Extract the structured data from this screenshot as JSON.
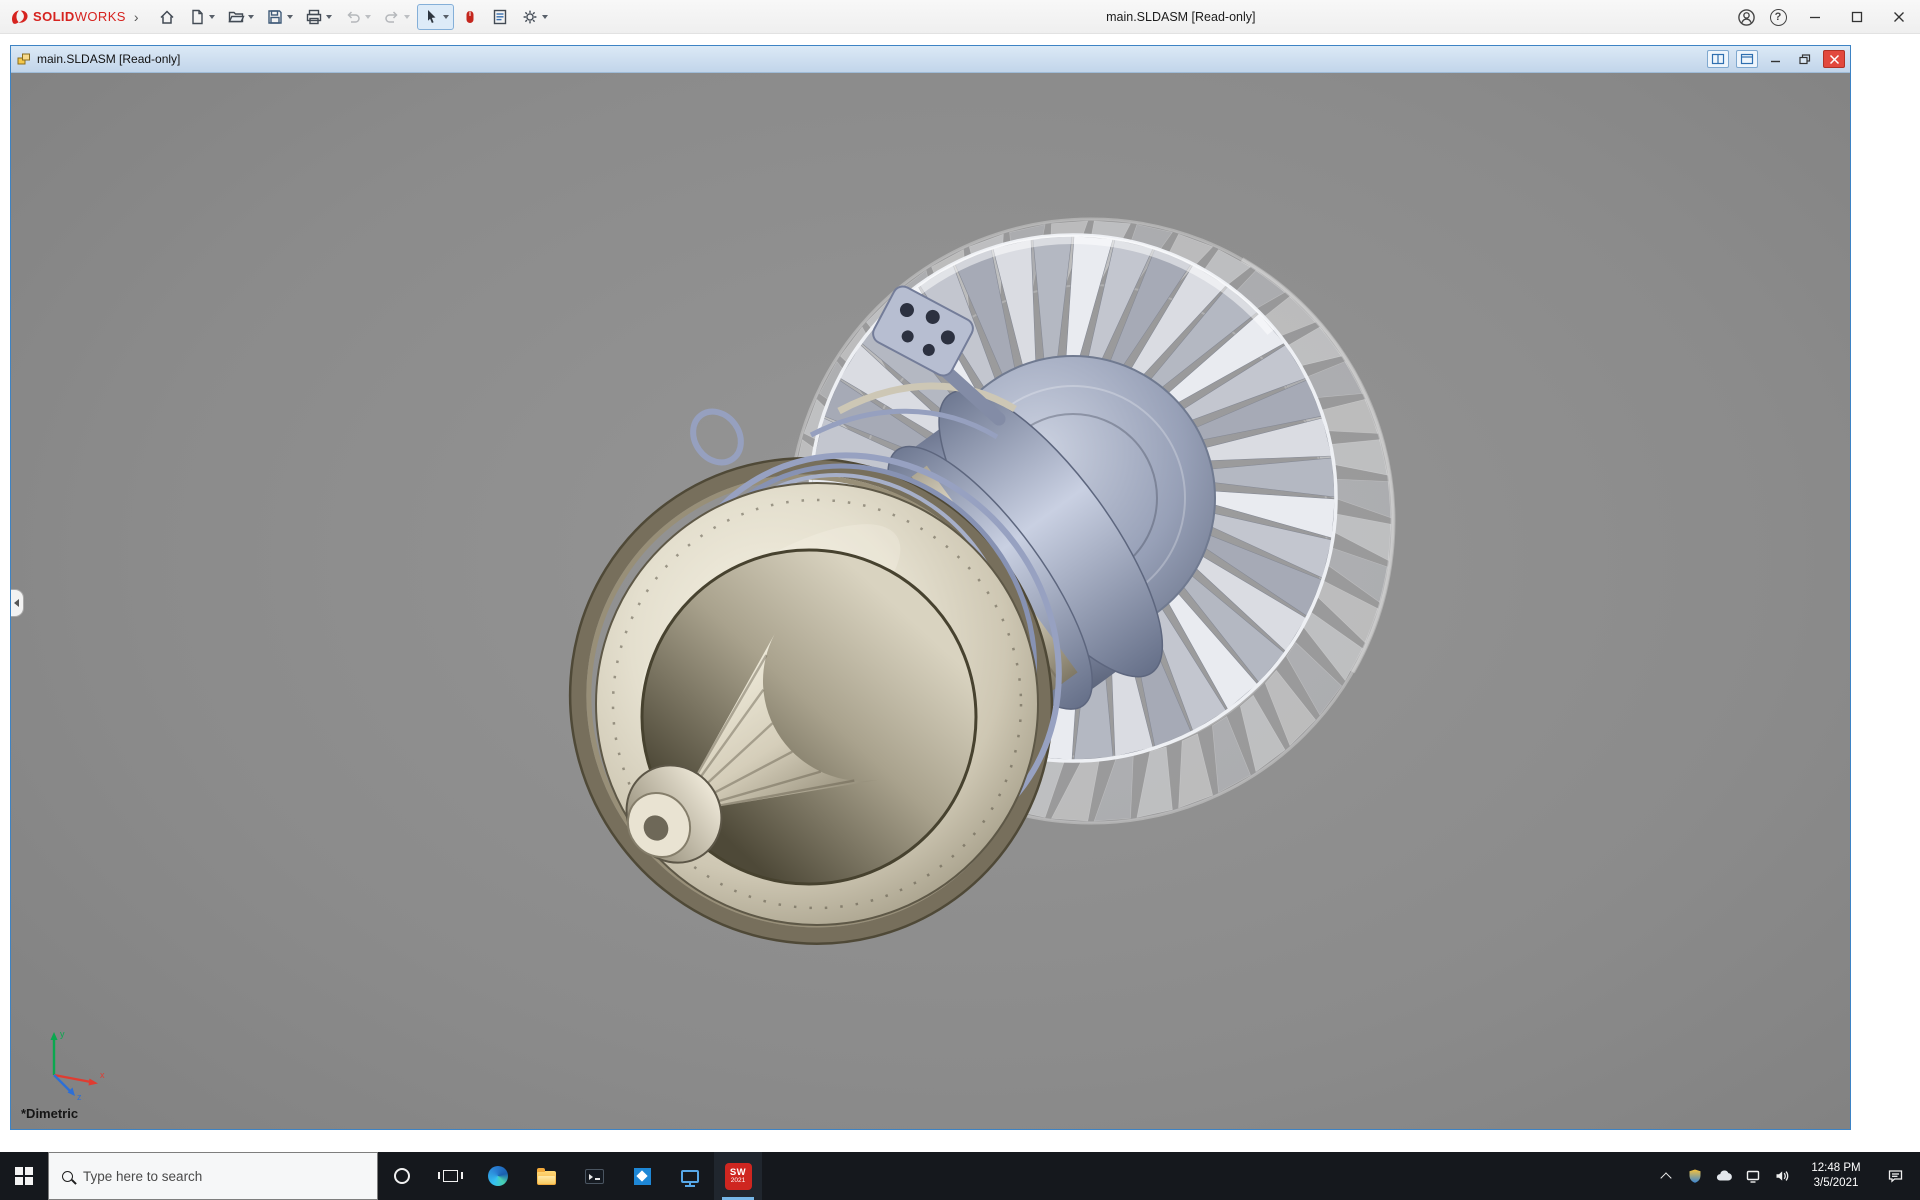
{
  "colors": {
    "solidworks_red": "#d6231f",
    "doc_titlebar_blue": "#cddff0",
    "window_border_blue": "#3d83c4",
    "viewport_gray": "#8c8c8c",
    "taskbar_black": "#15181d",
    "taskbar_accent": "#77b7e8",
    "close_button_red": "#e2493d",
    "engine_cream": "#e4dfce",
    "engine_lavender": "#a9b2c8"
  },
  "app": {
    "brand_bold": "SOLID",
    "brand_light": "WORKS",
    "menu_expand_glyph": "›",
    "title": "main.SLDASM [Read-only]",
    "help_glyph": "?",
    "toolbar_icons": [
      "home",
      "new-document",
      "open",
      "save",
      "print",
      "undo",
      "redo",
      "select",
      "mouse-gestures",
      "file-properties",
      "options"
    ],
    "titlebar_controls": [
      "account",
      "help",
      "minimize",
      "maximize",
      "close"
    ]
  },
  "document_window": {
    "icon": "assembly-document",
    "title": "main.SLDASM [Read-only]",
    "controls": [
      "show-window-preview",
      "new-window",
      "minimize",
      "restore",
      "close"
    ]
  },
  "viewport": {
    "view_orientation": "*Dimetric",
    "triad": {
      "x": "x",
      "y": "y",
      "z": "z"
    },
    "model": "jet-engine-assembly"
  },
  "taskbar": {
    "search_placeholder": "Type here to search",
    "pinned_apps": [
      "cortana",
      "task-view",
      "edge",
      "file-explorer",
      "command-prompt",
      "photos",
      "monitor-app",
      "solidworks-2021"
    ],
    "active_app": "solidworks-2021",
    "solidworks_badge": {
      "abbr": "SW",
      "year": "2021"
    },
    "tray_icons": [
      "hidden-icons",
      "security-shield",
      "onedrive-cloud",
      "network",
      "volume",
      "action-center"
    ],
    "clock": {
      "time": "12:48 PM",
      "date": "3/5/2021"
    }
  }
}
